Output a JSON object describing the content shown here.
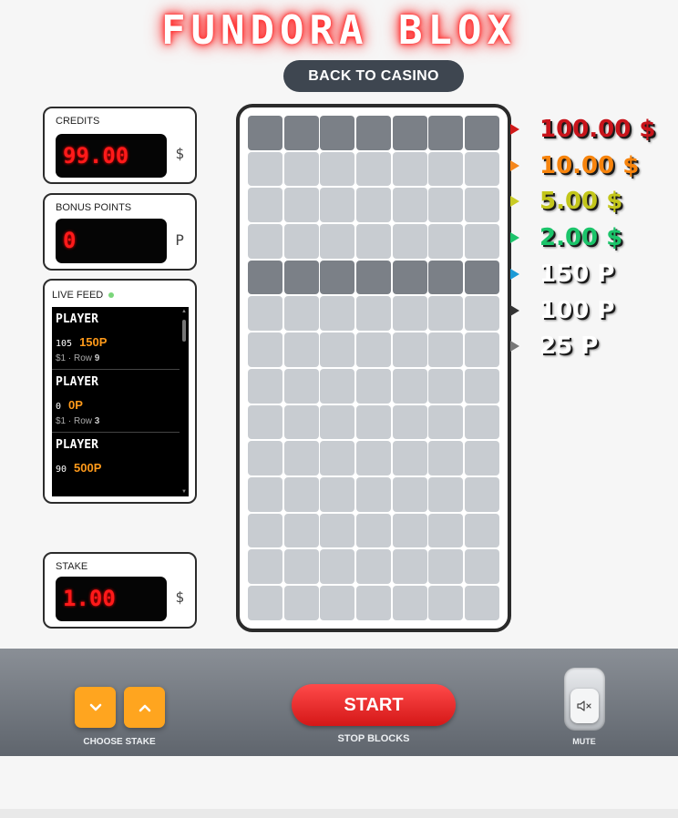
{
  "header": {
    "title": "FUNDORA BLOX",
    "back_label": "BACK TO CASINO"
  },
  "credits": {
    "label": "CREDITS",
    "value": "99.00",
    "unit": "$"
  },
  "bonus": {
    "label": "BONUS POINTS",
    "value": "0",
    "unit": "P"
  },
  "feed": {
    "label": "LIVE FEED",
    "items": [
      {
        "player": "PLAYER",
        "num": "105",
        "prize": "150P",
        "meta_prefix": "$1 · Row ",
        "row": "9"
      },
      {
        "player": "PLAYER",
        "num": "0",
        "prize": "0P",
        "meta_prefix": "$1 · Row ",
        "row": "3"
      },
      {
        "player": "PLAYER",
        "num": "90",
        "prize": "500P",
        "meta_prefix": "",
        "row": ""
      }
    ]
  },
  "stake": {
    "label": "STAKE",
    "value": "1.00",
    "unit": "$"
  },
  "board": {
    "columns": 7,
    "rows": 14,
    "active_rows": [
      0,
      4
    ]
  },
  "prizes": [
    {
      "text": "100.00 $",
      "color": "#c8141b",
      "arrow_color": "#d11a1a"
    },
    {
      "text": "10.00 $",
      "color": "#f7840d",
      "arrow_color": "#f5861a"
    },
    {
      "text": "5.00 $",
      "color": "#c3c61b",
      "arrow_color": "#c9cb24"
    },
    {
      "text": "2.00 $",
      "color": "#1bc46a",
      "arrow_color": "#1cc36b"
    },
    {
      "text": "150 P",
      "color": "#ffffff",
      "arrow_color": "#1b9ad6"
    },
    {
      "text": "100 P",
      "color": "#ffffff",
      "arrow_color": "#333333"
    },
    {
      "text": "25 P",
      "color": "#ffffff",
      "arrow_color": "#777777"
    }
  ],
  "controls": {
    "choose_stake_label": "CHOOSE STAKE",
    "down_icon": "chevron-down-icon",
    "up_icon": "chevron-up-icon",
    "start_label": "START",
    "stop_label": "STOP BLOCKS",
    "mute_label": "MUTE",
    "mute_icon": "speaker-muted-icon"
  },
  "colors": {
    "accent_orange": "#ffa51f",
    "start_red": "#e52b2b",
    "lcd_red": "#ff1a1a",
    "block_active": "#7b8087",
    "block_idle": "#c8ccd1"
  }
}
